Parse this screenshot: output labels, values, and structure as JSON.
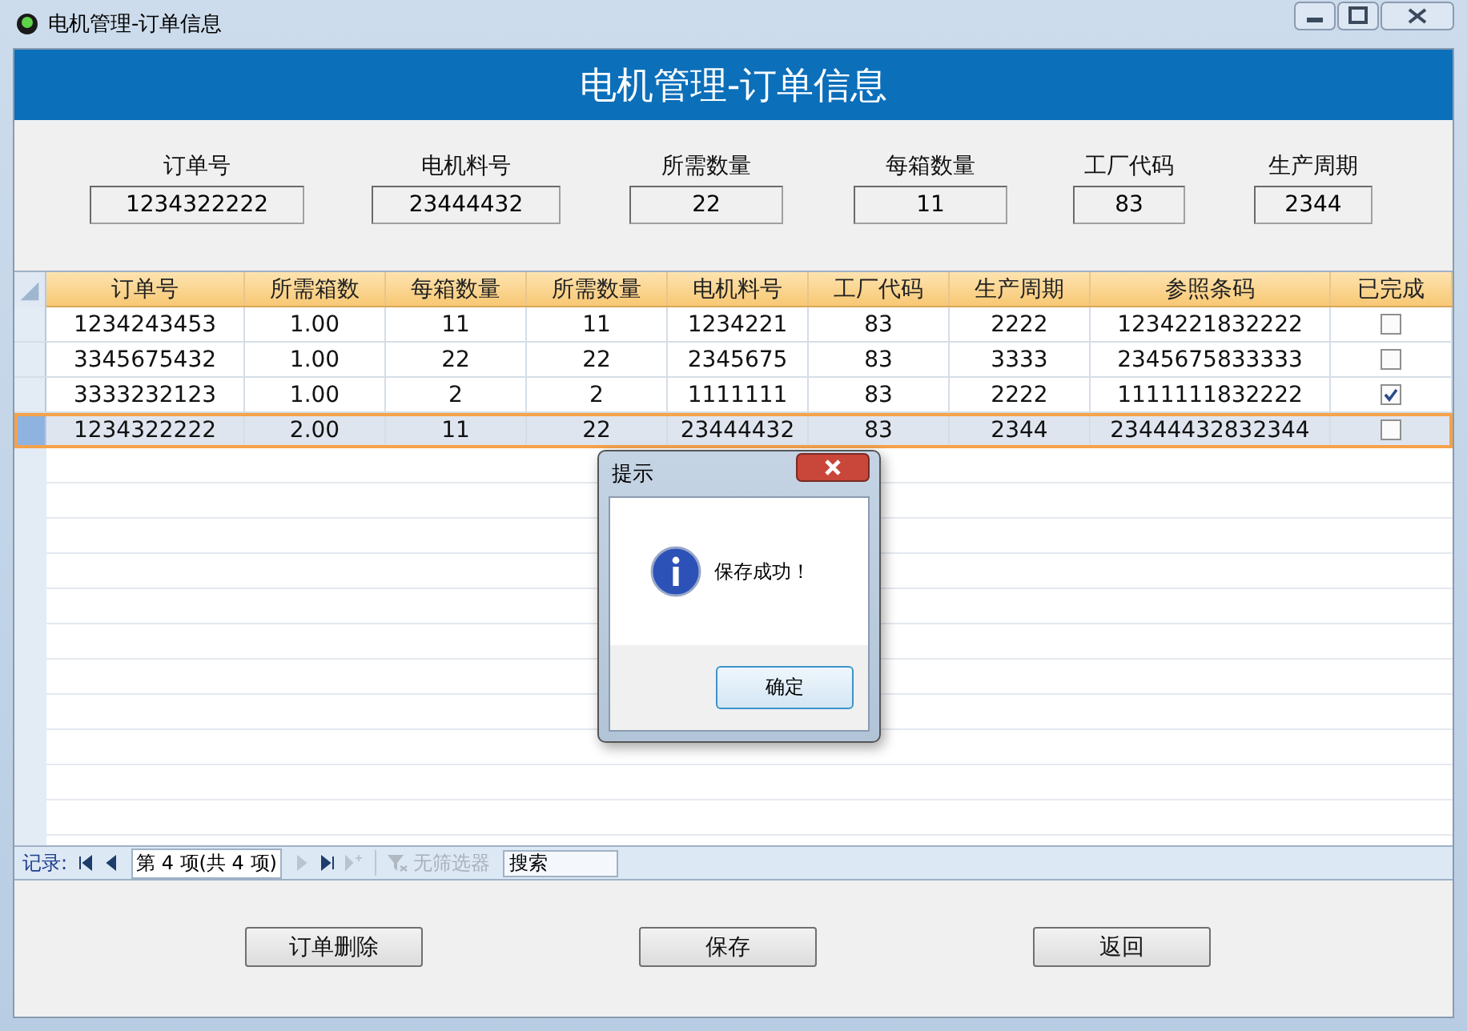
{
  "window": {
    "title": "电机管理-订单信息"
  },
  "header": {
    "title": "电机管理-订单信息"
  },
  "fields": [
    {
      "label": "订单号",
      "value": "1234322222"
    },
    {
      "label": "电机料号",
      "value": "23444432"
    },
    {
      "label": "所需数量",
      "value": "22"
    },
    {
      "label": "每箱数量",
      "value": "11"
    },
    {
      "label": "工厂代码",
      "value": "83"
    },
    {
      "label": "生产周期",
      "value": "2344"
    }
  ],
  "table": {
    "columns": [
      "订单号",
      "所需箱数",
      "每箱数量",
      "所需数量",
      "电机料号",
      "工厂代码",
      "生产周期",
      "参照条码",
      "已完成"
    ],
    "rows": [
      {
        "cells": [
          "1234243453",
          "1.00",
          "11",
          "11",
          "1234221",
          "83",
          "2222",
          "1234221832222"
        ],
        "done": false,
        "selected": false
      },
      {
        "cells": [
          "3345675432",
          "1.00",
          "22",
          "22",
          "2345675",
          "83",
          "3333",
          "2345675833333"
        ],
        "done": false,
        "selected": false
      },
      {
        "cells": [
          "3333232123",
          "1.00",
          "2",
          "2",
          "1111111",
          "83",
          "2222",
          "1111111832222"
        ],
        "done": true,
        "selected": false
      },
      {
        "cells": [
          "1234322222",
          "2.00",
          "11",
          "22",
          "23444432",
          "83",
          "2344",
          "23444432832344"
        ],
        "done": false,
        "selected": true
      }
    ]
  },
  "navigator": {
    "label": "记录:",
    "buttons_before": [
      {
        "kind": "first",
        "disabled": false
      },
      {
        "kind": "prev",
        "disabled": false
      }
    ],
    "position": "第 4 项(共 4 项)",
    "buttons_after": [
      {
        "kind": "next",
        "disabled": true
      },
      {
        "kind": "last",
        "disabled": false
      },
      {
        "kind": "new",
        "disabled": true
      }
    ],
    "filter": "无筛选器",
    "search": "搜索"
  },
  "buttons": [
    "订单删除",
    "保存",
    "返回"
  ],
  "dialog": {
    "title": "提示",
    "message": "保存成功！",
    "ok": "确定"
  }
}
